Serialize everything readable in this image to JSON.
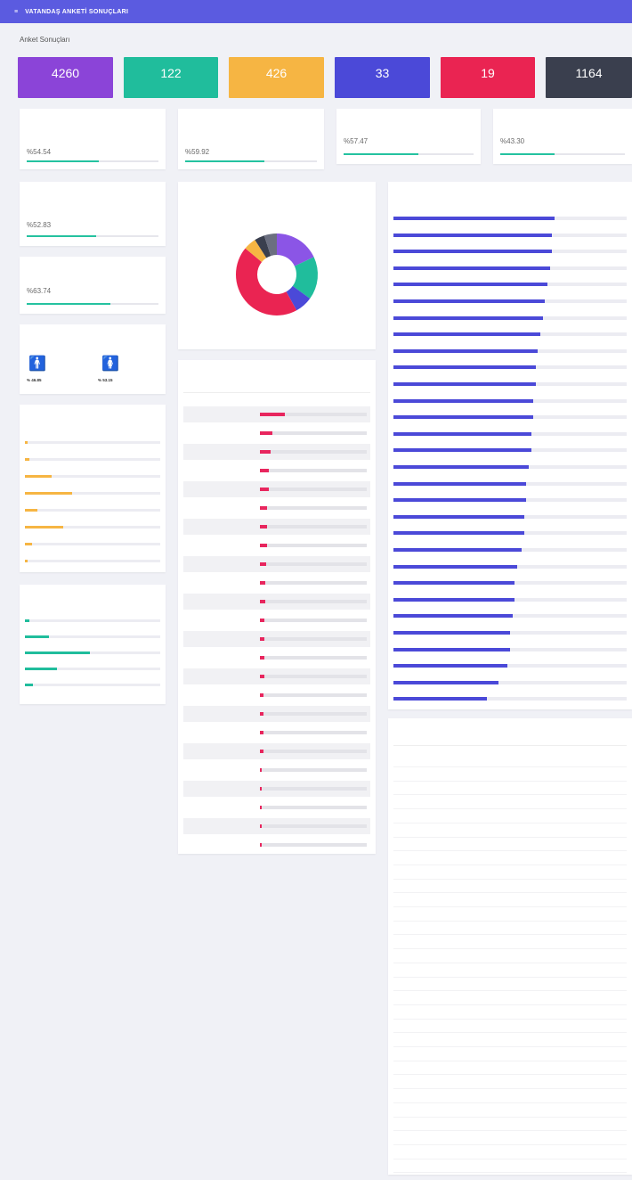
{
  "header": {
    "menu_icon": "menu-icon",
    "title": "VATANDAŞ ANKETİ SONUÇLARI"
  },
  "page_title": "Anket Sonuçları",
  "stats": [
    {
      "value": "4260",
      "color": "#8b44d8"
    },
    {
      "value": "122",
      "color": "#20bd9c"
    },
    {
      "value": "426",
      "color": "#f6b543"
    },
    {
      "value": "33",
      "color": "#4b49d8"
    },
    {
      "value": "19",
      "color": "#ea2452"
    },
    {
      "value": "1164",
      "color": "#3a3f4e"
    }
  ],
  "metric_cards": [
    {
      "value": "%54.54",
      "fraction": 0.5454
    },
    {
      "value": "%59.92",
      "fraction": 0.5992
    },
    {
      "value": "%57.47",
      "fraction": 0.5747
    },
    {
      "value": "%43.30",
      "fraction": 0.433
    },
    {
      "value": "%52.83",
      "fraction": 0.5283
    },
    {
      "value": "%63.74",
      "fraction": 0.6374
    }
  ],
  "gender": {
    "male_icon": "male-person-icon",
    "female_icon": "female-person-icon",
    "male_pct": "% 46.85",
    "female_pct": "% 53.15"
  },
  "education_rows": [
    {
      "fraction": 0.02,
      "color": "#f6b543"
    },
    {
      "fraction": 0.03,
      "color": "#f6b543"
    },
    {
      "fraction": 0.2,
      "color": "#f6b543"
    },
    {
      "fraction": 0.35,
      "color": "#f6b543"
    },
    {
      "fraction": 0.09,
      "color": "#f6b543"
    },
    {
      "fraction": 0.28,
      "color": "#f6b543"
    },
    {
      "fraction": 0.05,
      "color": "#f6b543"
    },
    {
      "fraction": 0.02,
      "color": "#f6b543"
    }
  ],
  "age_rows": [
    {
      "fraction": 0.03,
      "color": "#20bd9c"
    },
    {
      "fraction": 0.18,
      "color": "#20bd9c"
    },
    {
      "fraction": 0.48,
      "color": "#20bd9c"
    },
    {
      "fraction": 0.24,
      "color": "#20bd9c"
    },
    {
      "fraction": 0.06,
      "color": "#20bd9c"
    }
  ],
  "channel_chart": {
    "slices": [
      {
        "fraction": 0.18,
        "color": "#8b55e6"
      },
      {
        "fraction": 0.17,
        "color": "#20bd9c"
      },
      {
        "fraction": 0.07,
        "color": "#4b49d8"
      },
      {
        "fraction": 0.44,
        "color": "#ea2452"
      },
      {
        "fraction": 0.05,
        "color": "#f6b543"
      },
      {
        "fraction": 0.04,
        "color": "#3a3f4e"
      },
      {
        "fraction": 0.05,
        "color": "#6b6f80"
      }
    ]
  },
  "mahalle_rows": [
    {
      "fraction": 0.23
    },
    {
      "fraction": 0.12
    },
    {
      "fraction": 0.1
    },
    {
      "fraction": 0.08
    },
    {
      "fraction": 0.08
    },
    {
      "fraction": 0.07
    },
    {
      "fraction": 0.07
    },
    {
      "fraction": 0.07
    },
    {
      "fraction": 0.06
    },
    {
      "fraction": 0.05
    },
    {
      "fraction": 0.05
    },
    {
      "fraction": 0.04
    },
    {
      "fraction": 0.04
    },
    {
      "fraction": 0.04
    },
    {
      "fraction": 0.04
    },
    {
      "fraction": 0.03
    },
    {
      "fraction": 0.03
    },
    {
      "fraction": 0.03
    },
    {
      "fraction": 0.03
    },
    {
      "fraction": 0.02
    },
    {
      "fraction": 0.02
    },
    {
      "fraction": 0.02
    },
    {
      "fraction": 0.02
    },
    {
      "fraction": 0.02
    }
  ],
  "hizmet_rows": [
    {
      "fraction": 0.69
    },
    {
      "fraction": 0.68
    },
    {
      "fraction": 0.68
    },
    {
      "fraction": 0.67
    },
    {
      "fraction": 0.66
    },
    {
      "fraction": 0.65
    },
    {
      "fraction": 0.64
    },
    {
      "fraction": 0.63
    },
    {
      "fraction": 0.62
    },
    {
      "fraction": 0.61
    },
    {
      "fraction": 0.61
    },
    {
      "fraction": 0.6
    },
    {
      "fraction": 0.6
    },
    {
      "fraction": 0.59
    },
    {
      "fraction": 0.59
    },
    {
      "fraction": 0.58
    },
    {
      "fraction": 0.57
    },
    {
      "fraction": 0.57
    },
    {
      "fraction": 0.56
    },
    {
      "fraction": 0.56
    },
    {
      "fraction": 0.55
    },
    {
      "fraction": 0.53
    },
    {
      "fraction": 0.52
    },
    {
      "fraction": 0.52
    },
    {
      "fraction": 0.51
    },
    {
      "fraction": 0.5
    },
    {
      "fraction": 0.5
    },
    {
      "fraction": 0.49
    },
    {
      "fraction": 0.45
    },
    {
      "fraction": 0.4
    }
  ],
  "comment_row_count_note": ""
}
